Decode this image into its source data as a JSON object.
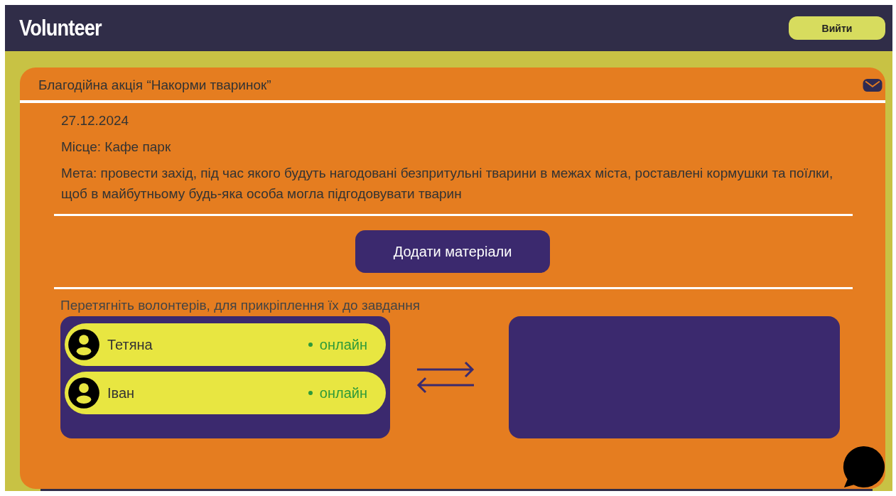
{
  "header": {
    "logo": "Volunteer",
    "logout_button": "Вийти"
  },
  "event": {
    "title": "Благодійна акція “Накорми тваринок”",
    "date": "27.12.2024",
    "place": "Місце: Кафе парк",
    "goal": "Мета: провести захід, під час якого будуть нагодовані безпритульні тварини в межах міста, роставлені кормушки та поїлки, щоб в майбутньому будь-яка особа могла підгодовувати тварин",
    "add_materials_button": "Додати матеріали",
    "drag_hint": "Перетягніть волонтерів, для прикріплення їх до завдання",
    "volunteers": [
      {
        "name": "Тетяна",
        "status": "онлайн",
        "online": true
      },
      {
        "name": "Іван",
        "status": "онлайн",
        "online": true
      }
    ]
  }
}
